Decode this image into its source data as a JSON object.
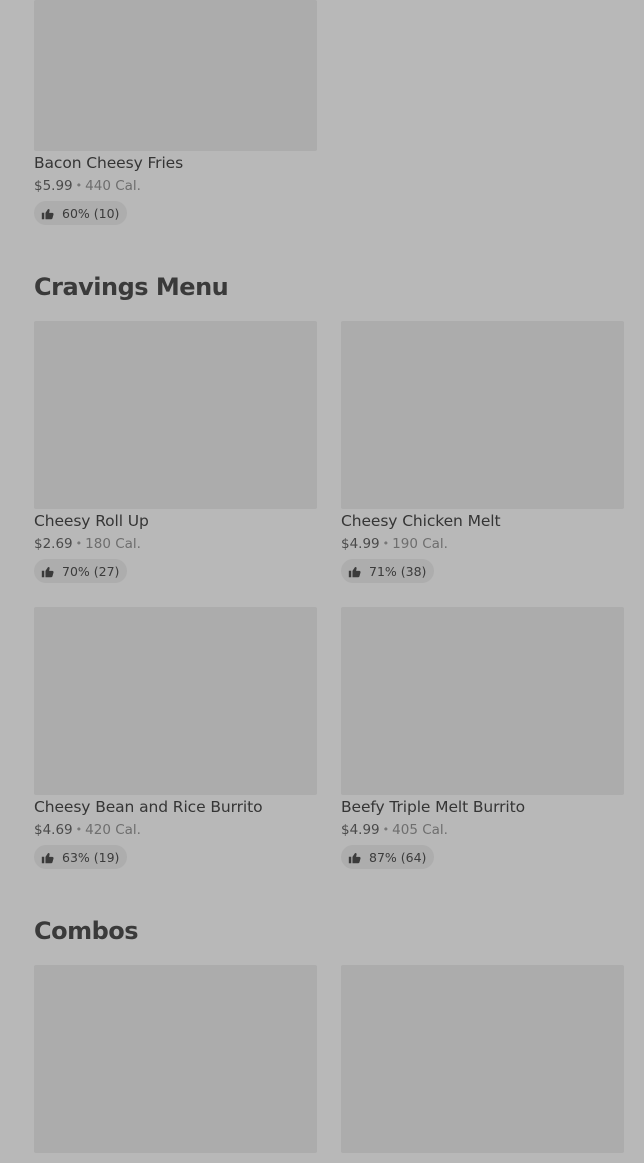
{
  "top_item": {
    "name": "Bacon Cheesy Fries",
    "price": "$5.99",
    "calories": "440 Cal.",
    "rating": "60% (10)"
  },
  "sections": [
    {
      "title": "Cravings Menu",
      "items": [
        {
          "name": "Cheesy Roll Up",
          "price": "$2.69",
          "calories": "180 Cal.",
          "rating": "70% (27)"
        },
        {
          "name": "Cheesy Chicken Melt",
          "price": "$4.99",
          "calories": "190 Cal.",
          "rating": "71% (38)"
        },
        {
          "name": "Cheesy Bean and Rice Burrito",
          "price": "$4.69",
          "calories": "420 Cal.",
          "rating": "63% (19)"
        },
        {
          "name": "Beefy Triple Melt Burrito",
          "price": "$4.99",
          "calories": "405 Cal.",
          "rating": "87% (64)"
        }
      ]
    },
    {
      "title": "Combos",
      "items": []
    }
  ],
  "separator": "•",
  "icons": {
    "rating": "thumbs-up-icon"
  }
}
